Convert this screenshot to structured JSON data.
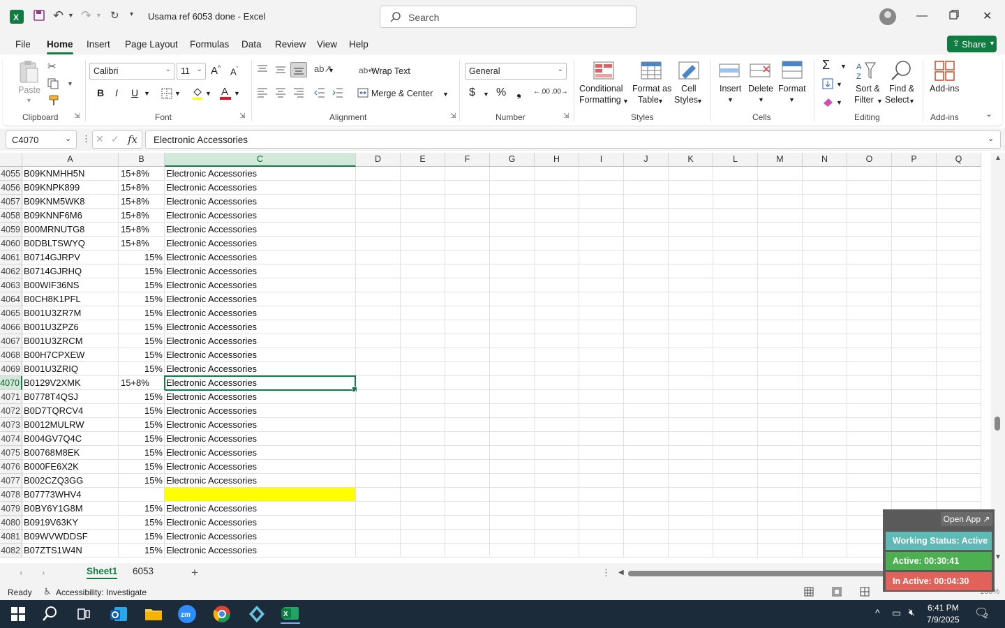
{
  "window": {
    "title": "Usama ref 6053 done  -  Excel",
    "search_placeholder": "Search"
  },
  "menu": {
    "tabs": [
      "File",
      "Home",
      "Insert",
      "Page Layout",
      "Formulas",
      "Data",
      "Review",
      "View",
      "Help"
    ],
    "active_tab": "Home",
    "share_label": "Share"
  },
  "ribbon": {
    "clipboard": {
      "paste": "Paste",
      "group": "Clipboard"
    },
    "font": {
      "name": "Calibri",
      "size": "11",
      "group": "Font"
    },
    "alignment": {
      "wrap_text": "Wrap Text",
      "merge_center": "Merge & Center",
      "group": "Alignment"
    },
    "number": {
      "format": "General",
      "group": "Number"
    },
    "styles": {
      "conditional_1": "Conditional",
      "conditional_2": "Formatting",
      "format_table_1": "Format as",
      "format_table_2": "Table",
      "cell_styles_1": "Cell",
      "cell_styles_2": "Styles",
      "group": "Styles"
    },
    "cells": {
      "insert": "Insert",
      "delete": "Delete",
      "format": "Format",
      "group": "Cells"
    },
    "editing": {
      "sort_1": "Sort &",
      "sort_2": "Filter",
      "find_1": "Find &",
      "find_2": "Select",
      "group": "Editing"
    },
    "addins": {
      "label": "Add-ins",
      "group": "Add-ins"
    }
  },
  "formula_bar": {
    "name_box": "C4070",
    "content": "Electronic Accessories"
  },
  "grid": {
    "columns": [
      "A",
      "B",
      "C",
      "D",
      "E",
      "F",
      "G",
      "H",
      "I",
      "J",
      "K",
      "L",
      "M",
      "N",
      "O",
      "P",
      "Q"
    ],
    "selected_column": "C",
    "selected_row": "4070",
    "rows": [
      {
        "n": "4055",
        "a": "B09KNMHH5N",
        "b": "15+8%",
        "c": "Electronic Accessories"
      },
      {
        "n": "4056",
        "a": "B09KNPK899",
        "b": "15+8%",
        "c": "Electronic Accessories"
      },
      {
        "n": "4057",
        "a": "B09KNM5WK8",
        "b": "15+8%",
        "c": "Electronic Accessories"
      },
      {
        "n": "4058",
        "a": "B09KNNF6M6",
        "b": "15+8%",
        "c": "Electronic Accessories"
      },
      {
        "n": "4059",
        "a": "B00MRNUTG8",
        "b": "15+8%",
        "c": "Electronic Accessories"
      },
      {
        "n": "4060",
        "a": "B0DBLTSWYQ",
        "b": "15+8%",
        "c": "Electronic Accessories"
      },
      {
        "n": "4061",
        "a": "B0714GJRPV",
        "b": "15%",
        "c": "Electronic Accessories"
      },
      {
        "n": "4062",
        "a": "B0714GJRHQ",
        "b": "15%",
        "c": "Electronic Accessories"
      },
      {
        "n": "4063",
        "a": "B00WIF36NS",
        "b": "15%",
        "c": "Electronic Accessories"
      },
      {
        "n": "4064",
        "a": "B0CH8K1PFL",
        "b": "15%",
        "c": "Electronic Accessories"
      },
      {
        "n": "4065",
        "a": "B001U3ZR7M",
        "b": "15%",
        "c": "Electronic Accessories"
      },
      {
        "n": "4066",
        "a": "B001U3ZPZ6",
        "b": "15%",
        "c": "Electronic Accessories"
      },
      {
        "n": "4067",
        "a": "B001U3ZRCM",
        "b": "15%",
        "c": "Electronic Accessories"
      },
      {
        "n": "4068",
        "a": "B00H7CPXEW",
        "b": "15%",
        "c": "Electronic Accessories"
      },
      {
        "n": "4069",
        "a": "B001U3ZRIQ",
        "b": "15%",
        "c": "Electronic Accessories"
      },
      {
        "n": "4070",
        "a": "B0129V2XMK",
        "b": "15+8%",
        "c": "Electronic Accessories"
      },
      {
        "n": "4071",
        "a": "B0778T4QSJ",
        "b": "15%",
        "c": "Electronic Accessories"
      },
      {
        "n": "4072",
        "a": "B0D7TQRCV4",
        "b": "15%",
        "c": "Electronic Accessories"
      },
      {
        "n": "4073",
        "a": "B0012MULRW",
        "b": "15%",
        "c": "Electronic Accessories"
      },
      {
        "n": "4074",
        "a": "B004GV7Q4C",
        "b": "15%",
        "c": "Electronic Accessories"
      },
      {
        "n": "4075",
        "a": "B00768M8EK",
        "b": "15%",
        "c": "Electronic Accessories"
      },
      {
        "n": "4076",
        "a": "B000FE6X2K",
        "b": "15%",
        "c": "Electronic Accessories"
      },
      {
        "n": "4077",
        "a": "B002CZQ3GG",
        "b": "15%",
        "c": "Electronic Accessories"
      },
      {
        "n": "4078",
        "a": "B07773WHV4",
        "b": "",
        "c": "",
        "highlight": "#ffff00"
      },
      {
        "n": "4079",
        "a": "B0BY6Y1G8M",
        "b": "15%",
        "c": "Electronic Accessories"
      },
      {
        "n": "4080",
        "a": "B0919V63KY",
        "b": "15%",
        "c": "Electronic Accessories"
      },
      {
        "n": "4081",
        "a": "B09WVWDDSF",
        "b": "15%",
        "c": "Electronic Accessories"
      },
      {
        "n": "4082",
        "a": "B07ZTS1W4N",
        "b": "15%",
        "c": "Electronic Accessories"
      }
    ]
  },
  "sheets": {
    "tabs": [
      "Sheet1",
      "6053"
    ],
    "active": "Sheet1"
  },
  "status": {
    "ready": "Ready",
    "accessibility": "Accessibility: Investigate",
    "zoom": "100%"
  },
  "overlay": {
    "open_app": "Open App ↗",
    "working_status": "Working Status: Active",
    "active_time": "Active: 00:30:41",
    "inactive_time": "In Active: 00:04:30",
    "colors": {
      "working": "#5fb9b5",
      "active": "#4caf50",
      "inactive": "#e0625a"
    }
  },
  "taskbar": {
    "time": "6:41 PM",
    "date": "7/9/2025",
    "notification_count": "2"
  },
  "colors": {
    "accent": "#107c41",
    "titlebar_bg": "#f3f3f3",
    "taskbar_bg": "#1c2b3a"
  }
}
